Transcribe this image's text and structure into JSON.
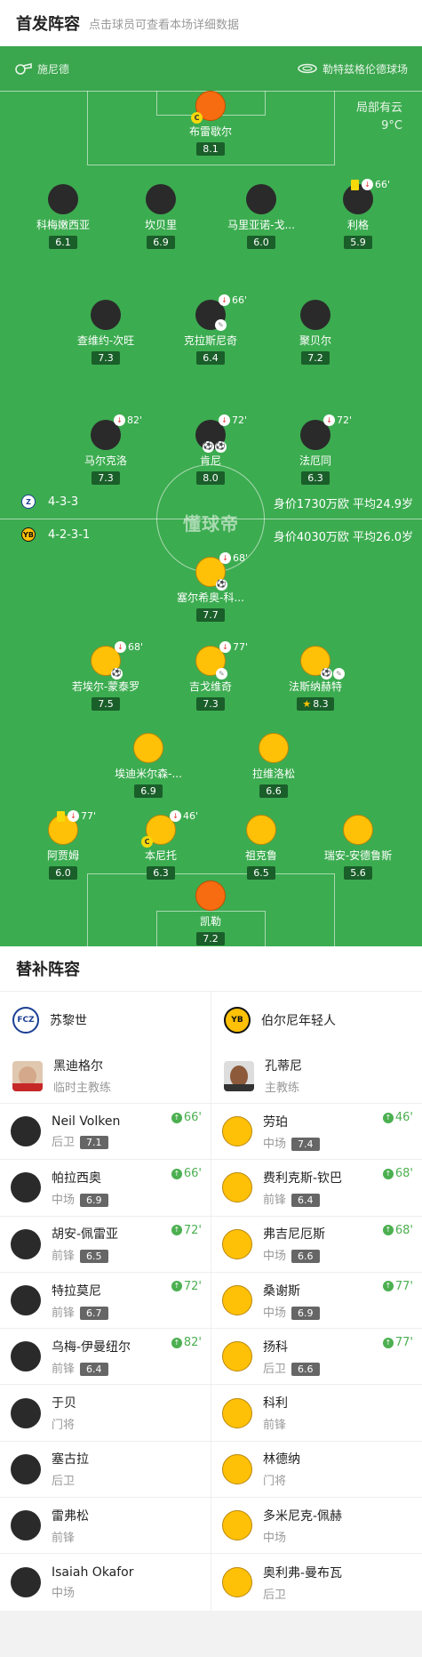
{
  "header": {
    "title": "首发阵容",
    "subtitle": "点击球员可查看本场详细数据"
  },
  "pitch": {
    "coach": "施尼德",
    "stadium": "勒特兹格伦德球场",
    "weather": "局部有云",
    "temperature": "9°C",
    "watermark": "懂球帝"
  },
  "home": {
    "formation": "4-3-3",
    "market": "身价1730万欧  平均24.9岁",
    "players": [
      {
        "name": "布雷歇尔",
        "rating": "8.1"
      },
      {
        "name": "科梅嫩西亚",
        "rating": "6.1"
      },
      {
        "name": "坎贝里",
        "rating": "6.9"
      },
      {
        "name": "马里亚诺-戈...",
        "rating": "6.0"
      },
      {
        "name": "利格",
        "rating": "5.9",
        "event": "66'"
      },
      {
        "name": "查维约-次旺",
        "rating": "7.3"
      },
      {
        "name": "克拉斯尼奇",
        "rating": "6.4",
        "event": "66'"
      },
      {
        "name": "聚贝尔",
        "rating": "7.2"
      },
      {
        "name": "马尔克洛",
        "rating": "7.3",
        "event": "82'"
      },
      {
        "name": "肯尼",
        "rating": "8.0",
        "event": "72'"
      },
      {
        "name": "法厄同",
        "rating": "6.3",
        "event": "72'"
      }
    ]
  },
  "away": {
    "formation": "4-2-3-1",
    "market": "身价4030万欧  平均26.0岁",
    "players": [
      {
        "name": "塞尔希奥-科...",
        "rating": "7.7",
        "event": "68'"
      },
      {
        "name": "若埃尔-蒙泰罗",
        "rating": "7.5",
        "event": "68'"
      },
      {
        "name": "吉戈维奇",
        "rating": "7.3",
        "event": "77'"
      },
      {
        "name": "法斯纳赫特",
        "rating": "8.3"
      },
      {
        "name": "埃迪米尔森-...",
        "rating": "6.9"
      },
      {
        "name": "拉维洛松",
        "rating": "6.6"
      },
      {
        "name": "阿贾姆",
        "rating": "6.0",
        "event": "77'"
      },
      {
        "name": "本尼托",
        "rating": "6.3",
        "event": "46'"
      },
      {
        "name": "祖克鲁",
        "rating": "6.5"
      },
      {
        "name": "瑞安-安德鲁斯",
        "rating": "5.6"
      },
      {
        "name": "凯勒",
        "rating": "7.2"
      }
    ]
  },
  "subs": {
    "title": "替补阵容",
    "home": {
      "team": "苏黎世",
      "coach_name": "黑迪格尔",
      "coach_role": "临时主教练",
      "players": [
        {
          "name": "Neil Volken",
          "pos": "后卫",
          "rating": "7.1",
          "in": "66'"
        },
        {
          "name": "帕拉西奥",
          "pos": "中场",
          "rating": "6.9",
          "in": "66'"
        },
        {
          "name": "胡安-佩雷亚",
          "pos": "前锋",
          "rating": "6.5",
          "in": "72'"
        },
        {
          "name": "特拉莫尼",
          "pos": "前锋",
          "rating": "6.7",
          "in": "72'"
        },
        {
          "name": "乌梅-伊曼纽尔",
          "pos": "前锋",
          "rating": "6.4",
          "in": "82'"
        },
        {
          "name": "于贝",
          "pos": "门将"
        },
        {
          "name": "塞古拉",
          "pos": "后卫"
        },
        {
          "name": "雷弗松",
          "pos": "前锋"
        },
        {
          "name": "Isaiah Okafor",
          "pos": "中场"
        }
      ]
    },
    "away": {
      "team": "伯尔尼年轻人",
      "coach_name": "孔蒂尼",
      "coach_role": "主教练",
      "players": [
        {
          "name": "劳珀",
          "pos": "中场",
          "rating": "7.4",
          "in": "46'"
        },
        {
          "name": "费利克斯-钦巴",
          "pos": "前锋",
          "rating": "6.4",
          "in": "68'"
        },
        {
          "name": "弗吉尼厄斯",
          "pos": "中场",
          "rating": "6.6",
          "in": "68'"
        },
        {
          "name": "桑谢斯",
          "pos": "中场",
          "rating": "6.9",
          "in": "77'"
        },
        {
          "name": "扬科",
          "pos": "后卫",
          "rating": "6.6",
          "in": "77'"
        },
        {
          "name": "科利",
          "pos": "前锋"
        },
        {
          "name": "林德纳",
          "pos": "门将"
        },
        {
          "name": "多米尼克-佩赫",
          "pos": "中场"
        },
        {
          "name": "奥利弗-曼布瓦",
          "pos": "后卫"
        }
      ]
    }
  }
}
